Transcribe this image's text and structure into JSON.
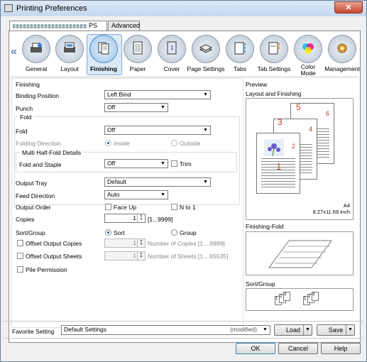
{
  "window": {
    "title": "Printing Preferences",
    "close": "✕"
  },
  "tabs": {
    "printer_suffix": "PS",
    "advanced": "Advanced"
  },
  "iconbar": {
    "items": [
      {
        "label": "General"
      },
      {
        "label": "Layout"
      },
      {
        "label": "Finishing"
      },
      {
        "label": "Paper"
      },
      {
        "label": "Cover"
      },
      {
        "label": "Page Settings"
      },
      {
        "label": "Tabs"
      },
      {
        "label": "Tab Settings"
      },
      {
        "label": "Color\nMode"
      },
      {
        "label": "Management"
      }
    ],
    "left_arrow": "«",
    "right_arrow": "»"
  },
  "finishing": {
    "section": "Finishing",
    "binding_position_label": "Binding Position",
    "binding_position_value": "Left Bind",
    "punch_label": "Punch",
    "punch_value": "Off",
    "fold_group": "Fold",
    "fold_label": "Fold",
    "fold_value": "Off",
    "folding_direction_label": "Folding Direction",
    "inside": "Inside",
    "outside": "Outside",
    "multi_half_group": "Multi Half-Fold Details",
    "fold_staple_label": "Fold and Staple",
    "fold_staple_value": "Off",
    "trim": "Trim",
    "output_tray_label": "Output Tray",
    "output_tray_value": "Default",
    "feed_direction_label": "Feed Direction",
    "feed_direction_value": "Auto",
    "output_order_label": "Output Order",
    "face_up": "Face Up",
    "n_to_1": "N to 1",
    "copies_label": "Copies",
    "copies_value": "1",
    "copies_range": "[1...9999]",
    "sort_group_label": "Sort/Group",
    "sort": "Sort",
    "group": "Group",
    "offset_copies_label": "Offset Output Copies",
    "offset_copies_value": "1",
    "offset_copies_hint": "Number of Copies [1....9999]",
    "offset_sheets_label": "Offset Output Sheets",
    "offset_sheets_value": "1",
    "offset_sheets_hint": "Number of Sheets [1....65535]",
    "pile_permission": "Pile Permission"
  },
  "preview": {
    "title": "Preview",
    "layout_label": "Layout and Finishing",
    "paper_size": "A4",
    "paper_dims": "8.27x11.69 inch",
    "page_numbers": [
      "5",
      "6",
      "3",
      "4",
      "1",
      "2"
    ],
    "finishing_fold_label": "Finishing-Fold",
    "sort_group_label": "Sort/Group",
    "sort_icons": [
      "1",
      "2",
      "3",
      "1",
      "2",
      "3"
    ]
  },
  "favorite": {
    "label": "Favorite Setting",
    "value": "Default Settings",
    "modified": "(modified)",
    "load": "Load",
    "save": "Save"
  },
  "buttons": {
    "ok": "OK",
    "cancel": "Cancel",
    "help": "Help"
  }
}
